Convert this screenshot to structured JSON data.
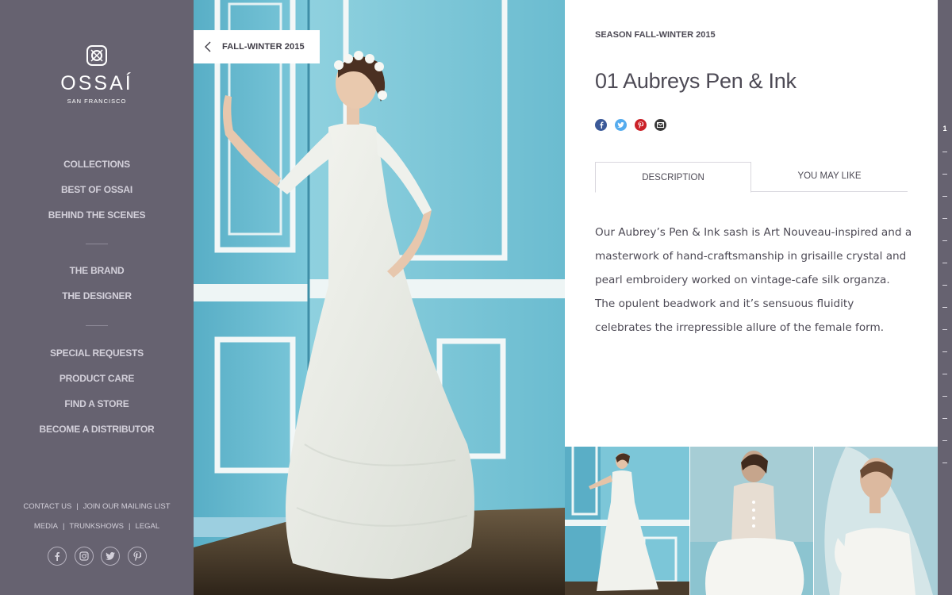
{
  "brand": {
    "name": "OSSAÍ",
    "tagline": "SAN FRANCISCO"
  },
  "sidebar": {
    "nav_primary": [
      "COLLECTIONS",
      "BEST OF OSSAI",
      "BEHIND THE SCENES"
    ],
    "nav_secondary": [
      "THE BRAND",
      "THE DESIGNER"
    ],
    "nav_tertiary": [
      "SPECIAL REQUESTS",
      "PRODUCT CARE",
      "FIND A STORE",
      "BECOME A DISTRIBUTOR"
    ],
    "footer_row1": [
      "CONTACT US",
      "JOIN OUR MAILING LIST"
    ],
    "footer_row2": [
      "MEDIA",
      "TRUNKSHOWS",
      "LEGAL"
    ],
    "footer_separator": "|",
    "social_icons": [
      "facebook-icon",
      "instagram-icon",
      "twitter-icon",
      "pinterest-icon"
    ]
  },
  "back_button": {
    "label": "FALL-WINTER 2015"
  },
  "product": {
    "season": "SEASON FALL-WINTER 2015",
    "title": "01 Aubreys Pen & Ink",
    "share_icons": [
      "facebook-icon",
      "twitter-icon",
      "pinterest-icon",
      "email-icon"
    ],
    "tabs": [
      "DESCRIPTION",
      "YOU MAY LIKE"
    ],
    "active_tab": "DESCRIPTION",
    "description": "Our Aubrey’s Pen & Ink sash is Art Nouveau-inspired and a masterwork of hand-craftsmanship in grisaille crystal and pearl embroidery worked on vintage-cafe silk organza. The opulent beadwork and it’s sensuous fluidity celebrates the irrepressible allure of the female form."
  },
  "pager": {
    "current": "1"
  },
  "colors": {
    "sidebar_bg": "#666270",
    "wall_blue": "#7cc6d8",
    "text_dark": "#4d4a55",
    "facebook": "#3b5998",
    "twitter": "#55acee",
    "pinterest": "#cb2027",
    "email": "#3a3a3a"
  }
}
